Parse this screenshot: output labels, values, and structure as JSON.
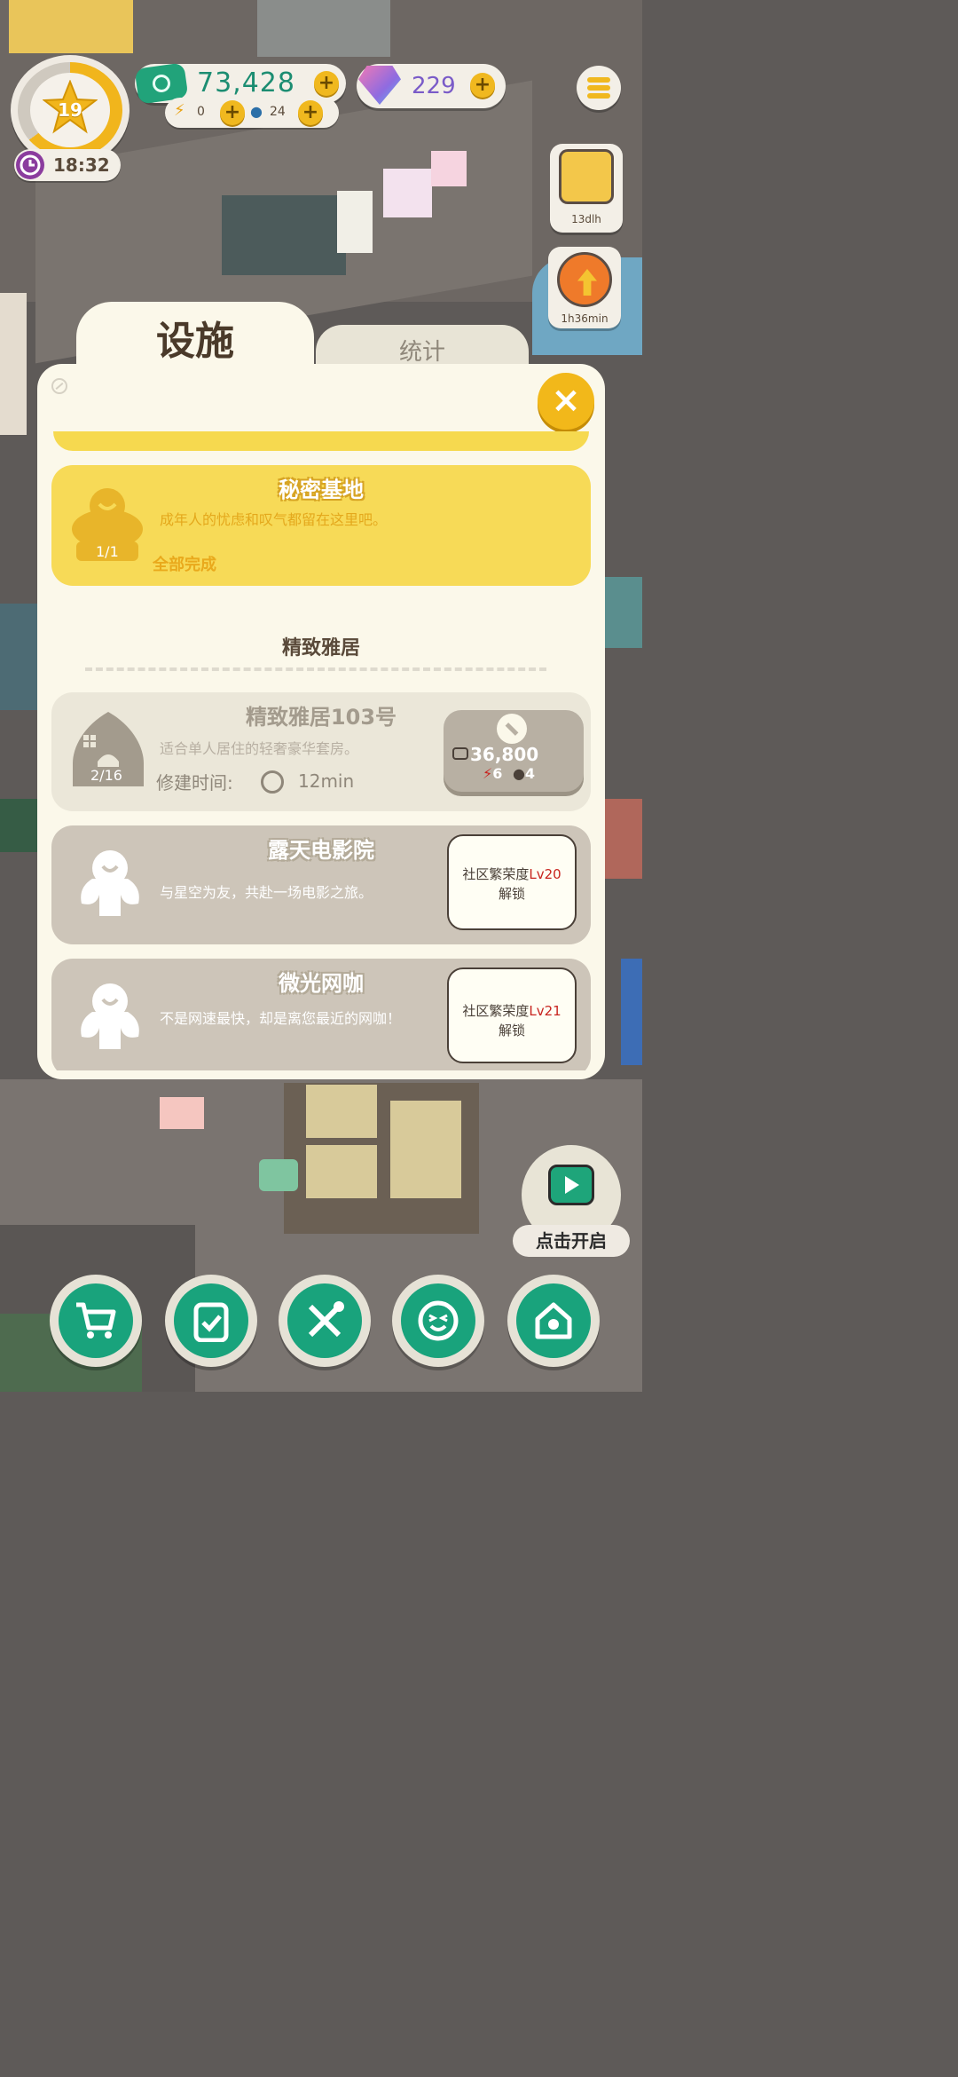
{
  "hud": {
    "level": "19",
    "clock_time": "18:32",
    "cash": "73,428",
    "energy": "0",
    "water": "24",
    "gems": "229",
    "plus_symbol": "+",
    "event_timer": "13dlh",
    "upgrade_timer": "1h36min"
  },
  "tabs": {
    "facilities": "设施",
    "statistics": "统计"
  },
  "close_symbol": "×",
  "cards": {
    "secret_base": {
      "title": "秘密基地",
      "desc": "成年人的忧虑和叹气都留在这里吧。",
      "progress": "1/1",
      "status": "全部完成"
    },
    "section_title": "精致雅居",
    "apartment": {
      "title": "精致雅居103号",
      "desc": "适合单人居住的轻奢豪华套房。",
      "progress": "2/16",
      "build_time_label": "修建时间:",
      "build_time_value": "12min",
      "cost": "36,800",
      "energy_req": "6",
      "water_req": "4"
    },
    "cinema": {
      "title": "露天电影院",
      "desc": "与星空为友，共赴一场电影之旅。",
      "unlock_prefix": "社区繁荣度",
      "unlock_level": "Lv20",
      "unlock_suffix": "解锁"
    },
    "cafe": {
      "title": "微光网咖",
      "desc": "不是网速最快，却是离您最近的网咖！",
      "unlock_prefix": "社区繁荣度",
      "unlock_level": "Lv21",
      "unlock_suffix": "解锁"
    }
  },
  "play_label": "点击开启",
  "nav_icons": [
    "cart-icon",
    "clipboard-check-icon",
    "tools-icon",
    "smile-face-icon",
    "house-wrench-icon"
  ],
  "colors": {
    "accent_yellow": "#f2b81a",
    "brand_green": "#19a37c",
    "panel_bg": "#fbf8ea",
    "unlock_red": "#c8241f"
  }
}
